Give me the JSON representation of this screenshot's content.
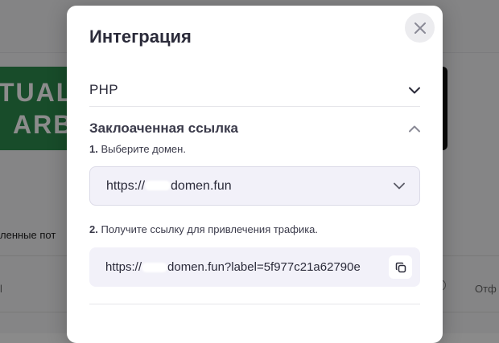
{
  "background": {
    "banner_line1": "TUAL",
    "banner_line2": "ARB",
    "tab_text": "ленные пот",
    "col_left": "l",
    "col_right": "Отф"
  },
  "modal": {
    "title": "Интеграция",
    "close_icon": "close-icon",
    "sections": {
      "php": {
        "label": "PHP",
        "state": "collapsed"
      },
      "link": {
        "label": "Заклоаченная ссылка",
        "state": "expanded"
      }
    },
    "step1": {
      "number": "1.",
      "text": "Выберите домен."
    },
    "domain_select": {
      "prefix": "https://",
      "suffix": "domen.fun"
    },
    "step2": {
      "number": "2.",
      "text": "Получите ссылку для привлечения трафика."
    },
    "tracking_link": {
      "prefix": "https://",
      "suffix": "domen.fun?label=5f977c21a62790e"
    }
  },
  "colors": {
    "banner_green": "#2d8a4e",
    "input_bg": "#f2f1f9",
    "title_text": "#2b2b3a"
  }
}
